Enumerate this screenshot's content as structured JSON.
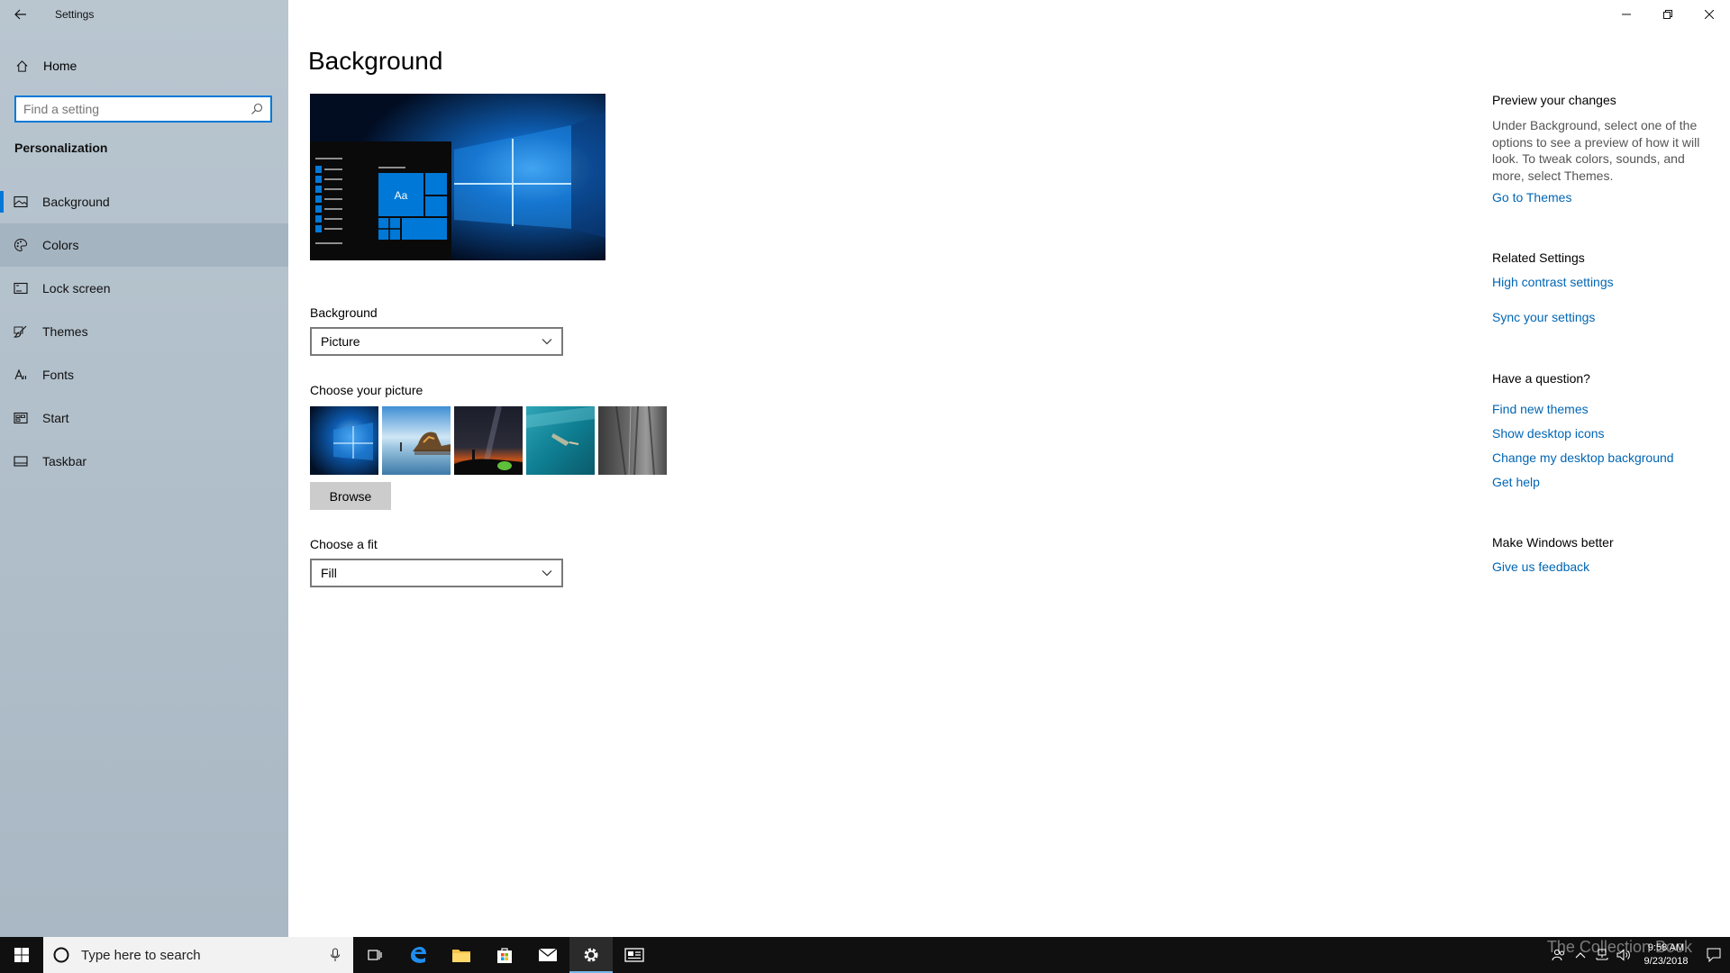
{
  "window": {
    "title": "Settings"
  },
  "sidebar": {
    "home_label": "Home",
    "search_placeholder": "Find a setting",
    "section_title": "Personalization",
    "items": [
      {
        "label": "Background",
        "icon": "picture-icon"
      },
      {
        "label": "Colors",
        "icon": "palette-icon"
      },
      {
        "label": "Lock screen",
        "icon": "lock-screen-icon"
      },
      {
        "label": "Themes",
        "icon": "brush-icon"
      },
      {
        "label": "Fonts",
        "icon": "font-icon"
      },
      {
        "label": "Start",
        "icon": "start-icon"
      },
      {
        "label": "Taskbar",
        "icon": "taskbar-icon"
      }
    ],
    "selected": "Background",
    "hovered": "Colors"
  },
  "main": {
    "title": "Background",
    "background_label": "Background",
    "background_value": "Picture",
    "choose_picture_label": "Choose your picture",
    "browse_label": "Browse",
    "fit_label": "Choose a fit",
    "fit_value": "Fill",
    "preview_tile_text": "Aa"
  },
  "side": {
    "preview_heading": "Preview your changes",
    "preview_text": "Under Background, select one of the options to see a preview of how it will look. To tweak colors, sounds, and more, select Themes.",
    "go_to_themes": "Go to Themes",
    "related_heading": "Related Settings",
    "high_contrast": "High contrast settings",
    "sync_settings": "Sync your settings",
    "question_heading": "Have a question?",
    "find_themes": "Find new themes",
    "show_icons": "Show desktop icons",
    "change_background": "Change my desktop background",
    "get_help": "Get help",
    "better_heading": "Make Windows better",
    "feedback": "Give us feedback"
  },
  "taskbar": {
    "search_placeholder": "Type here to search",
    "time": "9:58 AM",
    "date": "9/23/2018",
    "watermark": "The Collection Book"
  },
  "colors": {
    "accent": "#0078d7",
    "link": "#0066b4"
  }
}
